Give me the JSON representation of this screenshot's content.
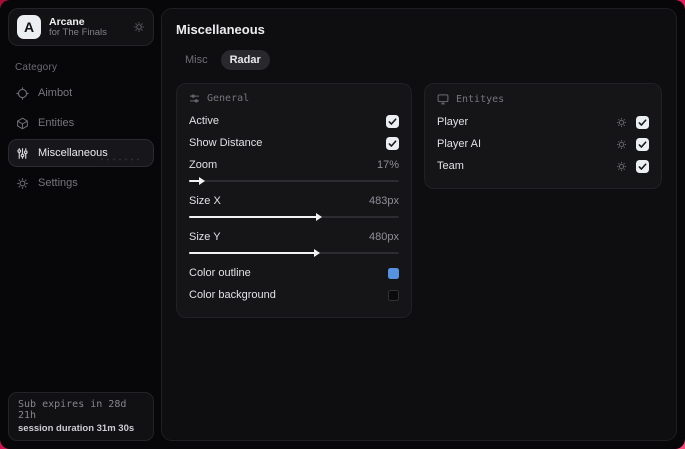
{
  "colors": {
    "frame_accent": "#e0175a",
    "outline_swatch": "#5593e0",
    "background_swatch": "#0a0a0a"
  },
  "sidebar": {
    "logo_letter": "A",
    "app_name": "Arcane",
    "app_subtitle": "for The Finals",
    "category_label": "Category",
    "items": [
      {
        "label": "Aimbot"
      },
      {
        "label": "Entities"
      },
      {
        "label": "Miscellaneous"
      },
      {
        "label": "Settings"
      }
    ],
    "sub_expires": "Sub expires in 28d 21h",
    "session_duration": "session duration 31m 30s"
  },
  "main": {
    "title": "Miscellaneous",
    "tabs": [
      {
        "label": "Misc"
      },
      {
        "label": "Radar"
      }
    ],
    "general": {
      "header": "General",
      "rows": {
        "active": {
          "label": "Active",
          "checked": true
        },
        "show_distance": {
          "label": "Show Distance",
          "checked": true
        },
        "zoom": {
          "label": "Zoom",
          "value": "17%",
          "fill_pct": 5
        },
        "size_x": {
          "label": "Size X",
          "value": "483px",
          "fill_pct": 61
        },
        "size_y": {
          "label": "Size Y",
          "value": "480px",
          "fill_pct": 60
        },
        "color_outline": {
          "label": "Color outline",
          "color": "#5593e0"
        },
        "color_background": {
          "label": "Color background",
          "color": "#0a0a0a"
        }
      }
    },
    "entities": {
      "header": "Entityes",
      "rows": [
        {
          "label": "Player",
          "checked": true
        },
        {
          "label": "Player AI",
          "checked": true
        },
        {
          "label": "Team",
          "checked": true
        }
      ]
    }
  }
}
